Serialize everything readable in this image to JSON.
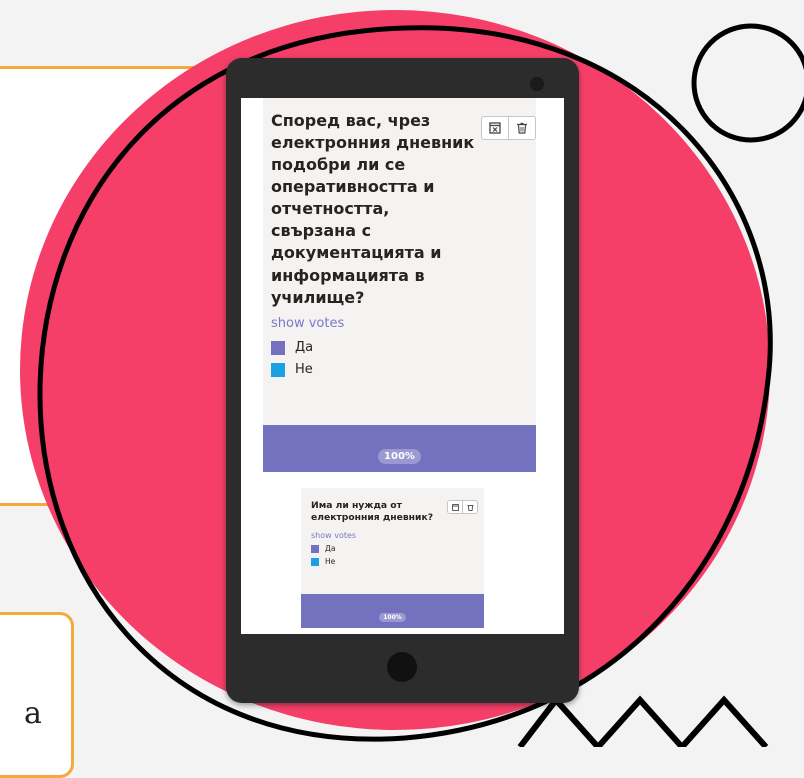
{
  "colors": {
    "background": "#f3f3f3",
    "blob": "#f53f69",
    "phone_body": "#2c2c2c",
    "orange_outline": "#f6a93b",
    "poll_card": "#f4f3f2",
    "vote_bar": "#7472bf",
    "option_yes": "#7472bf",
    "option_no": "#1ba1e2",
    "link": "#7b77c9"
  },
  "background_fragment": {
    "text": "a"
  },
  "polls": [
    {
      "question": "Според вас, чрез електронния дневник подобри ли се оперативността и отчетността, свързана с документацията и информацията в училище?",
      "show_votes": "show votes",
      "options": [
        {
          "label": "Да",
          "color": "#7472bf"
        },
        {
          "label": "Не",
          "color": "#1ba1e2"
        }
      ],
      "result_percent": "100%",
      "tool_icons": [
        "close-window-icon",
        "trash-icon"
      ]
    },
    {
      "question": "Има ли нужда от електронния дневник?",
      "show_votes": "show votes",
      "options": [
        {
          "label": "Да",
          "color": "#7472bf"
        },
        {
          "label": "Не",
          "color": "#1ba1e2"
        }
      ],
      "result_percent": "100%",
      "tool_icons": [
        "close-window-icon",
        "trash-icon"
      ]
    }
  ]
}
